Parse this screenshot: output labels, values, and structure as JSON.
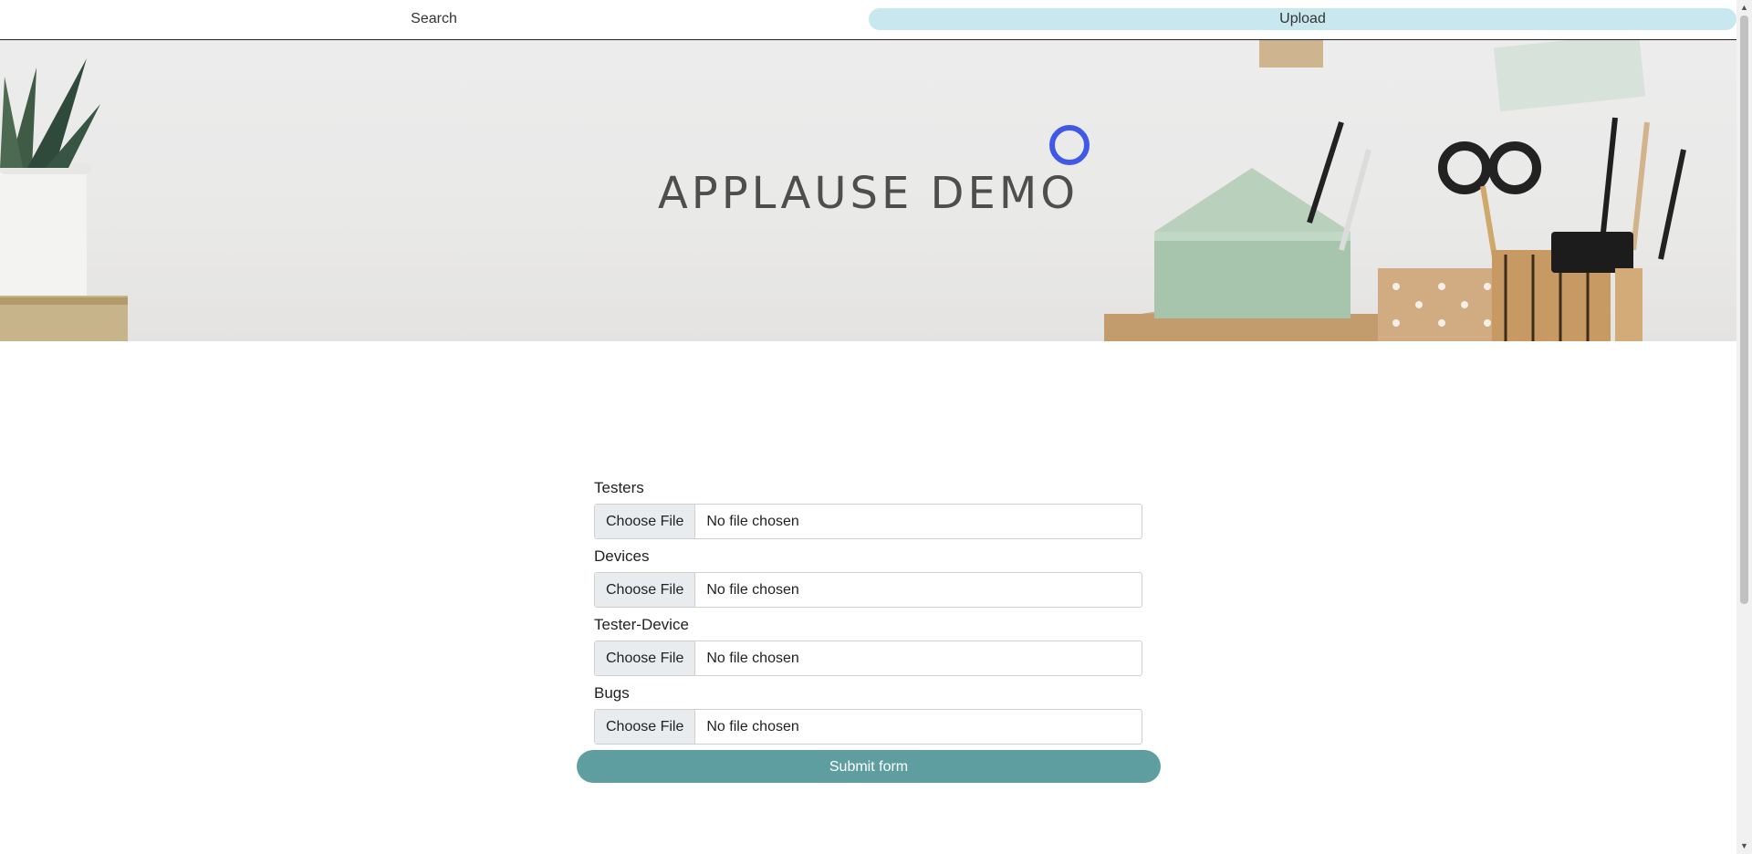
{
  "nav": {
    "search_label": "Search",
    "upload_label": "Upload",
    "active_tab": "upload",
    "active_bg": "#c8e8f0"
  },
  "hero": {
    "title": "APPLAUSE DEMO"
  },
  "form": {
    "fields": [
      {
        "label": "Testers",
        "button": "Choose File",
        "status": "No file chosen"
      },
      {
        "label": "Devices",
        "button": "Choose File",
        "status": "No file chosen"
      },
      {
        "label": "Tester-Device",
        "button": "Choose File",
        "status": "No file chosen"
      },
      {
        "label": "Bugs",
        "button": "Choose File",
        "status": "No file chosen"
      }
    ],
    "submit_label": "Submit form",
    "submit_color": "#5f9ea0"
  },
  "colors": {
    "cursor_ring": "#3f58e8"
  }
}
